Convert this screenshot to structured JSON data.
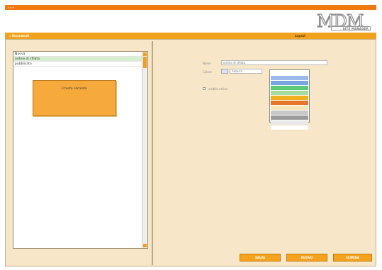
{
  "topbar": {
    "text": "«‹›»"
  },
  "logo": {
    "letters": "MDM",
    "tagline": "SITE MANAGER"
  },
  "nav": {
    "left_label": "» Documenti",
    "right_label": "Layout"
  },
  "list": {
    "items": [
      {
        "label": "Nuova"
      },
      {
        "label": "ordine di sfilata",
        "selected": true
      },
      {
        "label": "pubblicato"
      }
    ]
  },
  "note": {
    "text": "il testo corrente"
  },
  "form": {
    "nome_label": "Nome",
    "nome_value": "ordine di sfilata",
    "colore_label": "Colore",
    "colore_value": "Azzurro",
    "visible_label": "visibile online"
  },
  "palette": {
    "colors": [
      "#ffffff",
      "#9db8ea",
      "#7aa6e0",
      "#5cc87a",
      "#a6dca0",
      "#f0b020",
      "#e6762a",
      "#f4e6b8",
      "#c8c8c8",
      "#9c9c9c",
      "#e8e8e8",
      "#ffffff"
    ]
  },
  "buttons": {
    "salva": "SALVA",
    "nuovo": "NUOVO",
    "elimina": "ELIMINA"
  }
}
